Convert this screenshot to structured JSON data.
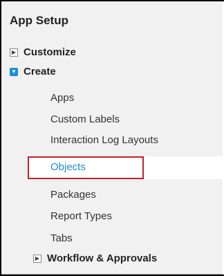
{
  "panel": {
    "title": "App Setup"
  },
  "tree": {
    "customize": {
      "label": "Customize",
      "state": "collapsed"
    },
    "create": {
      "label": "Create",
      "state": "expanded",
      "children": [
        "Apps",
        "Custom Labels",
        "Interaction Log Layouts",
        "Objects",
        "Packages",
        "Report Types",
        "Tabs"
      ],
      "selected": "Objects"
    },
    "workflow": {
      "label": "Workflow & Approvals",
      "state": "collapsed"
    }
  },
  "colors": {
    "panel_bg": "#f1f1f1",
    "selected_text": "#1a8ed0",
    "expanded_toggle": "#1b8fd0",
    "highlight_border": "#c0202a"
  },
  "icons": {
    "collapsed": "expand-triangle-icon",
    "expanded": "collapse-triangle-icon"
  }
}
